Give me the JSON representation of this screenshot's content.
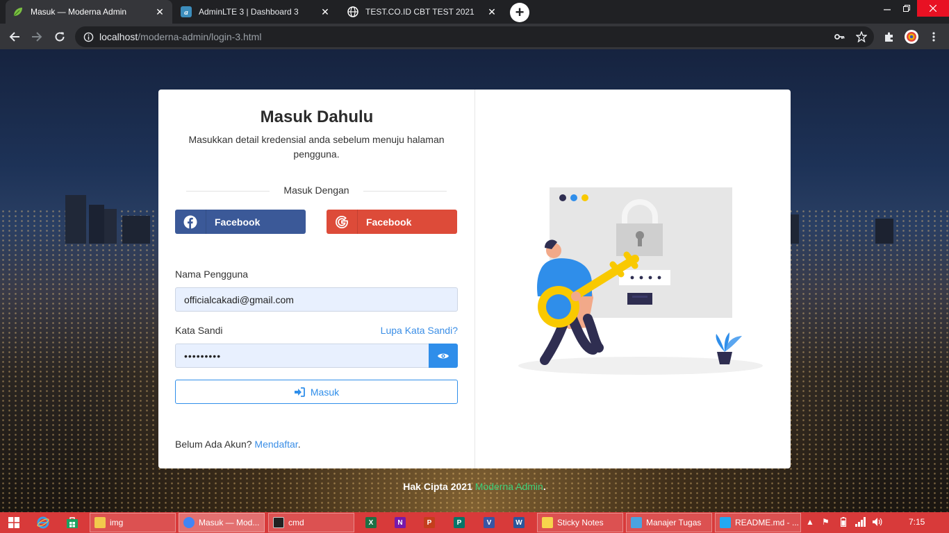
{
  "browser": {
    "tabs": [
      {
        "title": "Masuk — Moderna Admin",
        "icon": "leaf-icon",
        "active": true
      },
      {
        "title": "AdminLTE 3 | Dashboard 3",
        "icon": "adminlte-icon",
        "active": false
      },
      {
        "title": "TEST.CO.ID CBT TEST 2021",
        "icon": "globe-icon",
        "active": false
      }
    ],
    "close_glyph": "✕",
    "new_tab_glyph": "+",
    "url_host": "localhost",
    "url_path": "/moderna-admin/login-3.html"
  },
  "login": {
    "title": "Masuk Dahulu",
    "subtitle": "Masukkan detail kredensial anda sebelum menuju halaman pengguna.",
    "divider_text": "Masuk Dengan",
    "social_facebook_label": "Facebook",
    "social_google_label": "Facebook",
    "username_label": "Nama Pengguna",
    "username_value": "officialcakadi@gmail.com",
    "password_label": "Kata Sandi",
    "forgot_label": "Lupa Kata Sandi?",
    "password_value": "•••••••••",
    "submit_label": "Masuk",
    "signup_prefix": "Belum Ada Akun?",
    "signup_link": "Mendaftar",
    "signup_suffix": "."
  },
  "footer": {
    "prefix": "Hak Cipta 2021",
    "brand": "Moderna Admin",
    "suffix": "."
  },
  "taskbar": {
    "windows": [
      {
        "label": "img",
        "icon": "folder-icon",
        "color": "#f2c94c"
      },
      {
        "label": "Masuk — Mod...",
        "icon": "chrome-icon",
        "color": "#4285f4"
      },
      {
        "label": "cmd",
        "icon": "cmd-icon",
        "color": "#222222"
      },
      {
        "label": "Sticky Notes",
        "icon": "sticky-notes-icon",
        "color": "#f7d44c"
      },
      {
        "label": "Manajer Tugas",
        "icon": "task-manager-icon",
        "color": "#4aa3df"
      },
      {
        "label": "README.md - ...",
        "icon": "vscode-icon",
        "color": "#23a9f2"
      }
    ],
    "apps": [
      {
        "icon": "excel-icon",
        "glyph": "X",
        "color": "#1d7044"
      },
      {
        "icon": "onenote-icon",
        "glyph": "N",
        "color": "#7719aa"
      },
      {
        "icon": "powerpoint-icon",
        "glyph": "P",
        "color": "#c43e1c"
      },
      {
        "icon": "publisher-icon",
        "glyph": "P",
        "color": "#077568"
      },
      {
        "icon": "visio-icon",
        "glyph": "V",
        "color": "#3955a3"
      },
      {
        "icon": "word-icon",
        "glyph": "W",
        "color": "#2b579a"
      }
    ],
    "clock": "7:15"
  },
  "colors": {
    "facebook": "#3b5998",
    "google": "#dd4b39",
    "primary": "#2f8eea",
    "brand_green": "#3cd07a",
    "taskbar": "#d83a3a"
  }
}
